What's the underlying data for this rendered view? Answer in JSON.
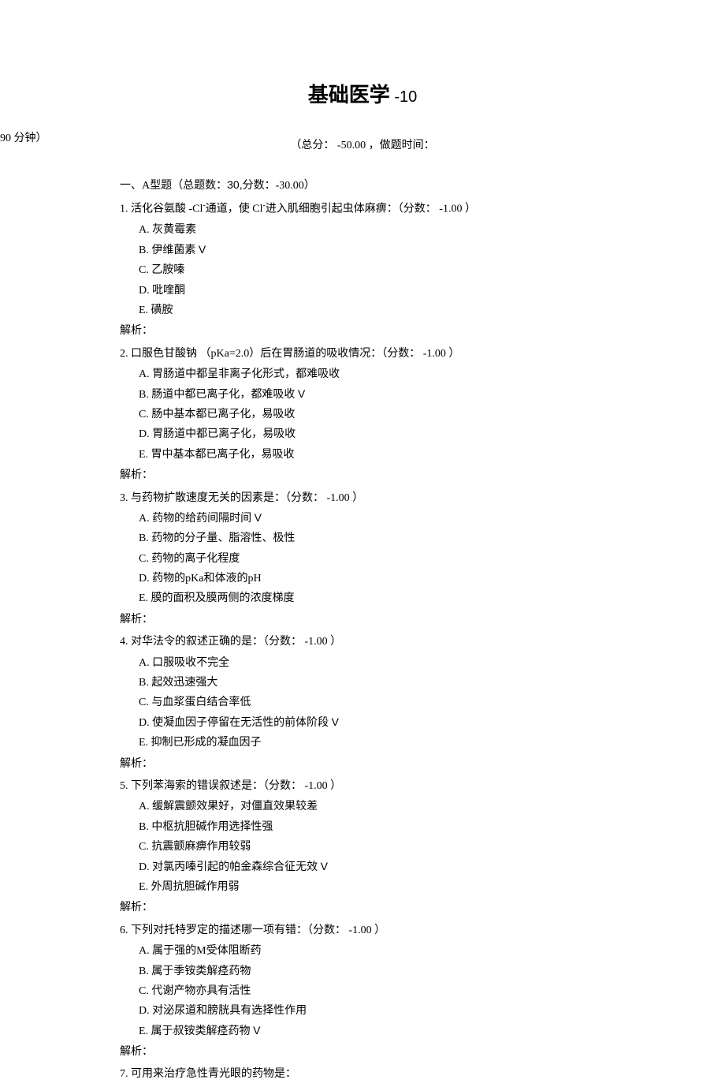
{
  "title": "基础医学",
  "title_suffix": " -10",
  "meta_left": "（总分：",
  "meta_score": " -50.00 ",
  "meta_mid": "，做题时间：",
  "time_stub": "90 分钟）",
  "section": {
    "prefix": "一、A型题（总题数：",
    "count": "30,",
    "score_label": "分数：-30.00）"
  },
  "questions": [
    {
      "num": "1.",
      "stem_pre": " 活化谷氨酸 -Cl",
      "stem_mid": "通道，使 Cl",
      "stem_post": "进入肌细胞引起虫体麻痹：（分数： -1.00 ）",
      "sup": "-",
      "options": [
        {
          "label": "A.",
          "text": " 灰黄霉素",
          "mark": ""
        },
        {
          "label": "B.",
          "text": " 伊维菌素 ",
          "mark": "V"
        },
        {
          "label": "C.",
          "text": " 乙胺嗪",
          "mark": ""
        },
        {
          "label": "D.",
          "text": " 吡喹酮",
          "mark": ""
        },
        {
          "label": "E.",
          "text": " 磺胺",
          "mark": ""
        }
      ],
      "analysis": "解析："
    },
    {
      "num": "2.",
      "stem": " 口服色甘酸钠 （pKa=2.0）后在胃肠道的吸收情况：（分数： -1.00 ）",
      "options": [
        {
          "label": "A.",
          "text": " 胃肠道中都呈非离子化形式，都难吸收",
          "mark": ""
        },
        {
          "label": "B.",
          "text": " 肠道中都已离子化，都难吸收 ",
          "mark": "V"
        },
        {
          "label": "C.",
          "text": " 肠中基本都已离子化，易吸收",
          "mark": ""
        },
        {
          "label": "D.",
          "text": " 胃肠道中都已离子化，易吸收",
          "mark": ""
        },
        {
          "label": "E.",
          "text": " 胃中基本都已离子化，易吸收",
          "mark": ""
        }
      ],
      "analysis": "解析："
    },
    {
      "num": "3.",
      "stem": " 与药物扩散速度无关的因素是：（分数： -1.00 ）",
      "options": [
        {
          "label": "A.",
          "text": " 药物的给药间隔时间 ",
          "mark": "V"
        },
        {
          "label": "B.",
          "text": " 药物的分子量、脂溶性、极性",
          "mark": ""
        },
        {
          "label": "C.",
          "text": " 药物的离子化程度",
          "mark": ""
        },
        {
          "label": "D.",
          "text": " 药物的pKa和体液的pH",
          "mark": ""
        },
        {
          "label": "E.",
          "text": " 膜的面积及膜两侧的浓度梯度",
          "mark": ""
        }
      ],
      "analysis": "解析："
    },
    {
      "num": "4.",
      "stem": " 对华法令的叙述正确的是：（分数： -1.00 ）",
      "options": [
        {
          "label": "A.",
          "text": " 口服吸收不完全",
          "mark": ""
        },
        {
          "label": "B.",
          "text": " 起效迅速强大",
          "mark": ""
        },
        {
          "label": "C.",
          "text": " 与血浆蛋白结合率低",
          "mark": ""
        },
        {
          "label": "D.",
          "text": " 使凝血因子停留在无活性的前体阶段    ",
          "mark": "V"
        },
        {
          "label": "E.",
          "text": " 抑制已形成的凝血因子",
          "mark": ""
        }
      ],
      "analysis": "解析："
    },
    {
      "num": "5.",
      "stem": " 下列苯海索的错误叙述是：（分数： -1.00 ）",
      "options": [
        {
          "label": "A.",
          "text": " 缓解震颤效果好，对僵直效果较差",
          "mark": ""
        },
        {
          "label": "B.",
          "text": " 中枢抗胆碱作用选择性强",
          "mark": ""
        },
        {
          "label": "C.",
          "text": " 抗震颤麻痹作用较弱",
          "mark": ""
        },
        {
          "label": "D.",
          "text": " 对氯丙嗪引起的帕金森综合征无效    ",
          "mark": "V"
        },
        {
          "label": "E.",
          "text": " 外周抗胆碱作用弱",
          "mark": ""
        }
      ],
      "analysis": "解析："
    },
    {
      "num": "6.",
      "stem": " 下列对托特罗定的描述哪一项有错：（分数： -1.00 ）",
      "options": [
        {
          "label": "A.",
          "text": " 属于强的M受体阻断药",
          "mark": ""
        },
        {
          "label": "B.",
          "text": " 属于季铵类解痉药物",
          "mark": ""
        },
        {
          "label": "C.",
          "text": " 代谢产物亦具有活性",
          "mark": ""
        },
        {
          "label": "D.",
          "text": " 对泌尿道和膀胱具有选择性作用",
          "mark": ""
        },
        {
          "label": "E.",
          "text": " 属于叔铵类解痉药物  ",
          "mark": "V"
        }
      ],
      "analysis": "解析："
    },
    {
      "num": "7.",
      "stem": " 可用来治疗急性青光眼的药物是：",
      "options": [],
      "analysis": ""
    }
  ]
}
